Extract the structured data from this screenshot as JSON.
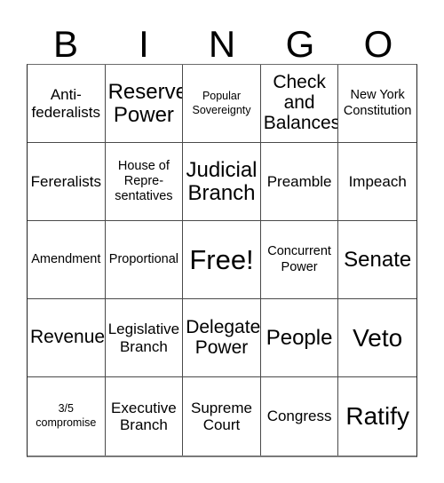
{
  "card": {
    "header_letters": [
      "B",
      "I",
      "N",
      "G",
      "O"
    ],
    "rows": [
      [
        {
          "text": "Anti-\nfederalists",
          "size": "md"
        },
        {
          "text": "Reserve\nPower",
          "size": "xl"
        },
        {
          "text": "Popular\nSovereignty",
          "size": "xs"
        },
        {
          "text": "Check\nand\nBalances",
          "size": "lg"
        },
        {
          "text": "New York\nConstitution",
          "size": "sm"
        }
      ],
      [
        {
          "text": "Fereralists",
          "size": "md"
        },
        {
          "text": "House of\nRepre-\nsentatives",
          "size": "sm"
        },
        {
          "text": "Judicial\nBranch",
          "size": "xl"
        },
        {
          "text": "Preamble",
          "size": "md"
        },
        {
          "text": "Impeach",
          "size": "md"
        }
      ],
      [
        {
          "text": "Amendment",
          "size": "sm"
        },
        {
          "text": "Proportional",
          "size": "sm"
        },
        {
          "text": "Free!",
          "size": "free"
        },
        {
          "text": "Concurrent\nPower",
          "size": "sm"
        },
        {
          "text": "Senate",
          "size": "xl"
        }
      ],
      [
        {
          "text": "Revenue",
          "size": "lg"
        },
        {
          "text": "Legislative\nBranch",
          "size": "md"
        },
        {
          "text": "Delegate\nPower",
          "size": "lg"
        },
        {
          "text": "People",
          "size": "xl"
        },
        {
          "text": "Veto",
          "size": "xxl"
        }
      ],
      [
        {
          "text": "3/5\ncompromise",
          "size": "xs"
        },
        {
          "text": "Executive\nBranch",
          "size": "md"
        },
        {
          "text": "Supreme\nCourt",
          "size": "md"
        },
        {
          "text": "Congress",
          "size": "md"
        },
        {
          "text": "Ratify",
          "size": "xxl"
        }
      ]
    ]
  },
  "colors": {
    "background": "#ffffff",
    "text": "#000000",
    "grid_line": "#4a4a4a",
    "outer_border": "#232323"
  }
}
